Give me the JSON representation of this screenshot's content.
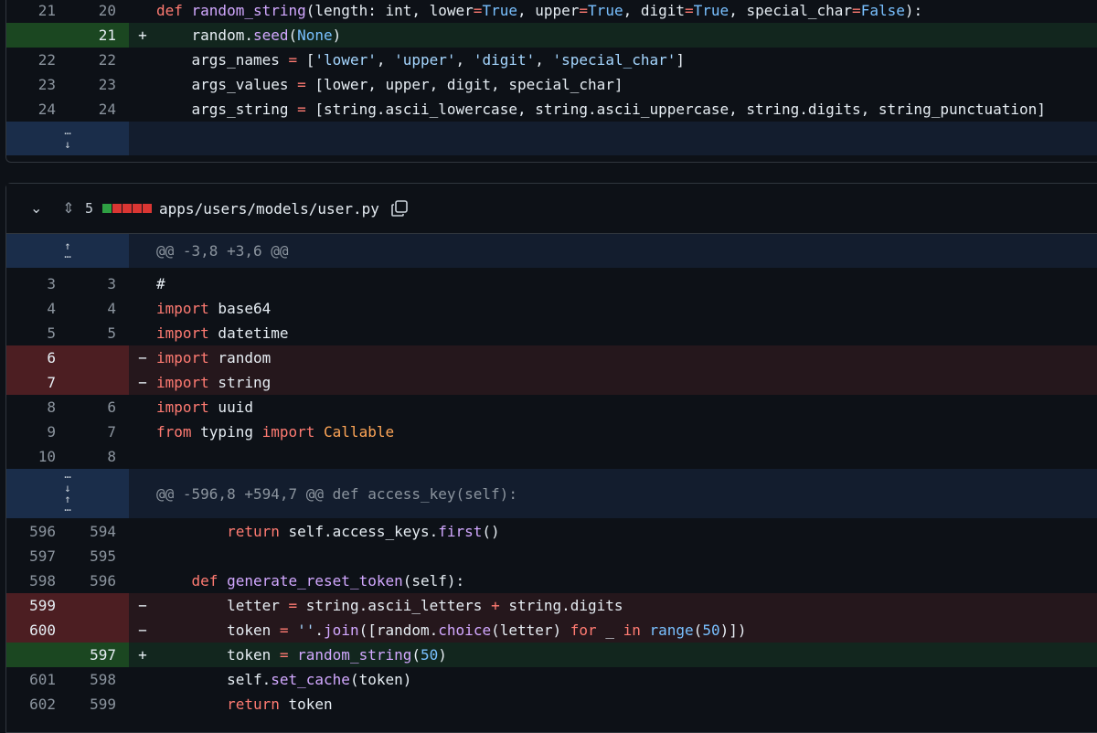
{
  "file1": {
    "rows": [
      {
        "type": "ctx",
        "old": "21",
        "new": "20",
        "sign": "",
        "code": [
          [
            "kw",
            "def "
          ],
          [
            "fn",
            "random_string"
          ],
          [
            "",
            "(length: int, lower"
          ],
          [
            "kw",
            "="
          ],
          [
            "bi",
            "True"
          ],
          [
            "",
            ", upper"
          ],
          [
            "kw",
            "="
          ],
          [
            "bi",
            "True"
          ],
          [
            "",
            ", digit"
          ],
          [
            "kw",
            "="
          ],
          [
            "bi",
            "True"
          ],
          [
            "",
            ", special_char"
          ],
          [
            "kw",
            "="
          ],
          [
            "bi",
            "False"
          ],
          [
            "",
            "):"
          ]
        ]
      },
      {
        "type": "add",
        "old": "",
        "new": "21",
        "sign": "+",
        "code": [
          [
            "",
            "    random."
          ],
          [
            "fn",
            "seed"
          ],
          [
            "",
            "("
          ],
          [
            "bi",
            "None"
          ],
          [
            "",
            ")"
          ]
        ]
      },
      {
        "type": "ctx",
        "old": "22",
        "new": "22",
        "sign": "",
        "code": [
          [
            "",
            "    args_names "
          ],
          [
            "kw",
            "="
          ],
          [
            "",
            " ["
          ],
          [
            "st",
            "'lower'"
          ],
          [
            "",
            ", "
          ],
          [
            "st",
            "'upper'"
          ],
          [
            "",
            ", "
          ],
          [
            "st",
            "'digit'"
          ],
          [
            "",
            ", "
          ],
          [
            "st",
            "'special_char'"
          ],
          [
            "",
            "]"
          ]
        ]
      },
      {
        "type": "ctx",
        "old": "23",
        "new": "23",
        "sign": "",
        "code": [
          [
            "",
            "    args_values "
          ],
          [
            "kw",
            "="
          ],
          [
            "",
            " [lower, upper, digit, special_char]"
          ]
        ]
      },
      {
        "type": "ctx",
        "old": "24",
        "new": "24",
        "sign": "",
        "code": [
          [
            "",
            "    args_string "
          ],
          [
            "kw",
            "="
          ],
          [
            "",
            " [string.ascii_lowercase, string.ascii_uppercase, string.digits, string_punctuation]"
          ]
        ]
      }
    ],
    "expand_icon": "expand-down-icon"
  },
  "file2": {
    "change_count": "5",
    "diffstat": [
      "#2ea043",
      "#da3633",
      "#da3633",
      "#da3633",
      "#da3633"
    ],
    "path": "apps/users/models/user.py",
    "hunk1": "@@ -3,8 +3,6 @@",
    "rows1": [
      {
        "type": "ctx",
        "old": "3",
        "new": "3",
        "sign": "",
        "code": [
          [
            "",
            "#"
          ]
        ]
      },
      {
        "type": "ctx",
        "old": "4",
        "new": "4",
        "sign": "",
        "code": [
          [
            "kw",
            "import"
          ],
          [
            "",
            " base64"
          ]
        ]
      },
      {
        "type": "ctx",
        "old": "5",
        "new": "5",
        "sign": "",
        "code": [
          [
            "kw",
            "import"
          ],
          [
            "",
            " datetime"
          ]
        ]
      },
      {
        "type": "del",
        "old": "6",
        "new": "",
        "sign": "−",
        "code": [
          [
            "kw",
            "import"
          ],
          [
            "",
            " random"
          ]
        ]
      },
      {
        "type": "del",
        "old": "7",
        "new": "",
        "sign": "−",
        "code": [
          [
            "kw",
            "import"
          ],
          [
            "",
            " string"
          ]
        ]
      },
      {
        "type": "ctx",
        "old": "8",
        "new": "6",
        "sign": "",
        "code": [
          [
            "kw",
            "import"
          ],
          [
            "",
            " uuid"
          ]
        ]
      },
      {
        "type": "ctx",
        "old": "9",
        "new": "7",
        "sign": "",
        "code": [
          [
            "kw",
            "from"
          ],
          [
            "",
            " typing "
          ],
          [
            "kw",
            "import"
          ],
          [
            "",
            " "
          ],
          [
            "cl",
            "Callable"
          ]
        ]
      },
      {
        "type": "ctx",
        "old": "10",
        "new": "8",
        "sign": "",
        "code": [
          [
            "",
            ""
          ]
        ]
      }
    ],
    "hunk2": "@@ -596,8 +594,7 @@ def access_key(self):",
    "rows2": [
      {
        "type": "ctx",
        "old": "596",
        "new": "594",
        "sign": "",
        "code": [
          [
            "",
            "        "
          ],
          [
            "kw",
            "return"
          ],
          [
            "",
            " self.access_keys."
          ],
          [
            "fn",
            "first"
          ],
          [
            "",
            "()"
          ]
        ]
      },
      {
        "type": "ctx",
        "old": "597",
        "new": "595",
        "sign": "",
        "code": [
          [
            "",
            ""
          ]
        ]
      },
      {
        "type": "ctx",
        "old": "598",
        "new": "596",
        "sign": "",
        "code": [
          [
            "",
            "    "
          ],
          [
            "kw",
            "def"
          ],
          [
            "",
            " "
          ],
          [
            "fn",
            "generate_reset_token"
          ],
          [
            "",
            "(self):"
          ]
        ]
      },
      {
        "type": "del",
        "old": "599",
        "new": "",
        "sign": "−",
        "code": [
          [
            "",
            "        letter "
          ],
          [
            "kw",
            "="
          ],
          [
            "",
            " string.ascii_letters "
          ],
          [
            "kw",
            "+"
          ],
          [
            "",
            " string.digits"
          ]
        ]
      },
      {
        "type": "del",
        "old": "600",
        "new": "",
        "sign": "−",
        "code": [
          [
            "",
            "        token "
          ],
          [
            "kw",
            "="
          ],
          [
            "",
            " "
          ],
          [
            "st",
            "''"
          ],
          [
            "",
            "."
          ],
          [
            "fn",
            "join"
          ],
          [
            "",
            "([random."
          ],
          [
            "fn",
            "choice"
          ],
          [
            "",
            "(letter) "
          ],
          [
            "kw",
            "for"
          ],
          [
            "",
            " _ "
          ],
          [
            "kw",
            "in"
          ],
          [
            "",
            " "
          ],
          [
            "bi",
            "range"
          ],
          [
            "",
            "("
          ],
          [
            "bi",
            "50"
          ],
          [
            "",
            ")])"
          ]
        ]
      },
      {
        "type": "add",
        "old": "",
        "new": "597",
        "sign": "+",
        "code": [
          [
            "",
            "        token "
          ],
          [
            "kw",
            "="
          ],
          [
            "",
            " "
          ],
          [
            "fn",
            "random_string"
          ],
          [
            "",
            "("
          ],
          [
            "bi",
            "50"
          ],
          [
            "",
            ")"
          ]
        ]
      },
      {
        "type": "ctx",
        "old": "601",
        "new": "598",
        "sign": "",
        "code": [
          [
            "",
            "        self."
          ],
          [
            "fn",
            "set_cache"
          ],
          [
            "",
            "(token)"
          ]
        ]
      },
      {
        "type": "ctx",
        "old": "602",
        "new": "599",
        "sign": "",
        "code": [
          [
            "",
            "        "
          ],
          [
            "kw",
            "return"
          ],
          [
            "",
            " token"
          ]
        ]
      }
    ]
  }
}
